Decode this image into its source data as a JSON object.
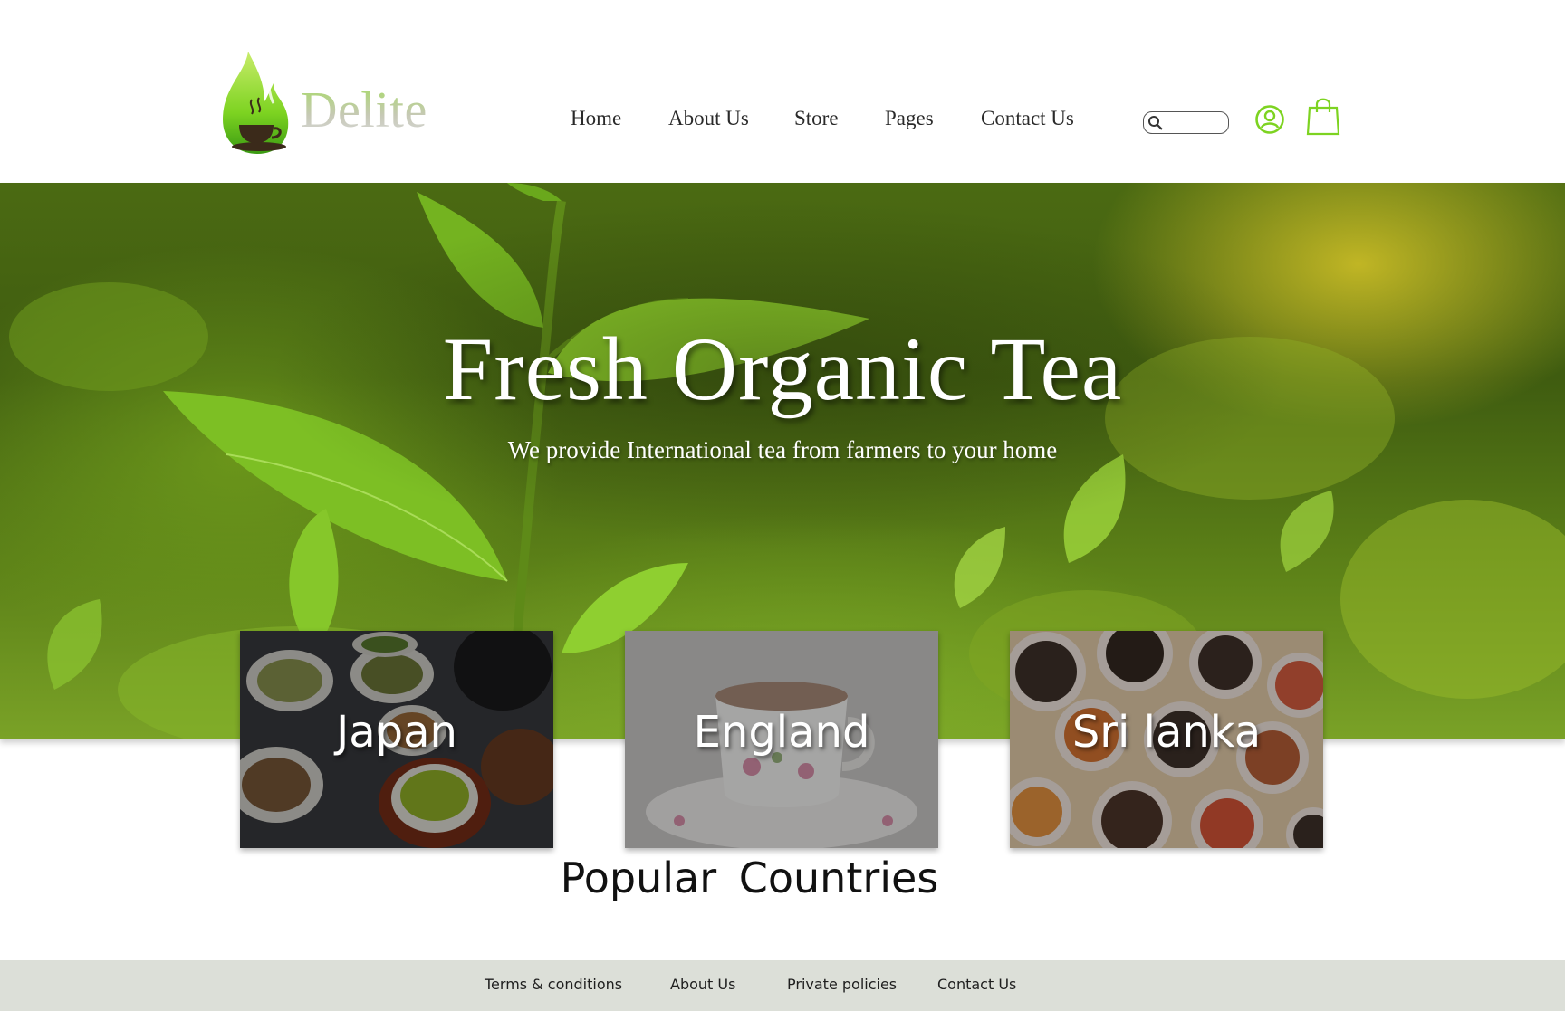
{
  "brand": {
    "name": "Delite"
  },
  "nav": {
    "items": [
      "Home",
      "About Us",
      "Store",
      "Pages",
      "Contact Us"
    ]
  },
  "search": {
    "placeholder": ""
  },
  "icons": {
    "search": "search-icon",
    "user": "user-circle-icon",
    "cart": "shopping-bag-icon"
  },
  "hero": {
    "title": "Fresh Organic Tea",
    "subtitle": "We provide International tea from farmers to your home"
  },
  "countries": {
    "title": "Popular  Countries",
    "cards": [
      "Japan",
      "England",
      "Sri lanka"
    ]
  },
  "footer": {
    "links": [
      "Terms & conditions",
      "About Us",
      "Private policies",
      "Contact Us"
    ]
  },
  "colors": {
    "accent": "#7dd321",
    "footer_bg": "#dcdfd8",
    "hero_green": "#4b6a12"
  }
}
